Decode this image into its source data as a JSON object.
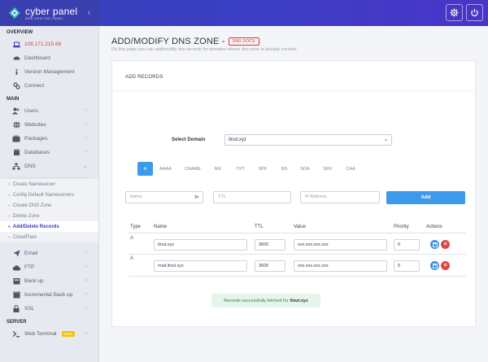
{
  "brand": {
    "title": "cyber panel",
    "subtitle": "WEB HOSTING PANEL"
  },
  "sidebar": {
    "overview_title": "OVERVIEW",
    "ip": "108.171.215.68",
    "overview_items": [
      "Dashboard",
      "Version Management",
      "Connect"
    ],
    "main_title": "MAIN",
    "main_items": [
      "Users",
      "Websites",
      "Packages",
      "Databases",
      "DNS"
    ],
    "dns_sub": [
      "Create Nameserver",
      "Config Default Nameservers",
      "Create DNS Zone",
      "Delete Zone",
      "Add/Delete Records",
      "CloudFlare"
    ],
    "more_items": [
      "Email",
      "FTP",
      "Back up",
      "Incremental Back up",
      "SSL"
    ],
    "server_title": "SERVER",
    "web_terminal": "Web Terminal",
    "new_badge": "NEW"
  },
  "page": {
    "title": "ADD/MODIFY DNS ZONE -",
    "docs_badge": "DNS DOCS",
    "description": "On this page you can add/modify dns records for domains whose dns zone is already created."
  },
  "card": {
    "title": "ADD RECORDS",
    "select_label": "Select Domain",
    "select_value": "itnut.xyz",
    "tabs": [
      "A",
      "AAAA",
      "CNAME",
      "MX",
      "TXT",
      "SPF",
      "NS",
      "SOA",
      "SRV",
      "CAA"
    ],
    "active_tab": "A",
    "inputs": {
      "name": "Name",
      "ttl": "TTL",
      "ip": "IP Address"
    },
    "add_button": "Add"
  },
  "table": {
    "headers": [
      "Type",
      "Name",
      "TTL",
      "Value",
      "Priority",
      "Actions"
    ],
    "rows": [
      {
        "type": "A",
        "name": "itnut.xyz",
        "ttl": "3600",
        "value": "xxx.xxx.xxx.xxx",
        "priority": "0"
      },
      {
        "type": "A",
        "name": "mail.itnut.xyz",
        "ttl": "3600",
        "value": "xxx.xxx.xxx.xxx",
        "priority": "0"
      }
    ]
  },
  "alert": {
    "text": "Records successfully fetched for",
    "domain": "itnut.xyz"
  },
  "colors": {
    "accent": "#3b9aea",
    "topbar": "#3b3fc4",
    "danger": "#e24545",
    "success_bg": "#e6f5e9"
  }
}
